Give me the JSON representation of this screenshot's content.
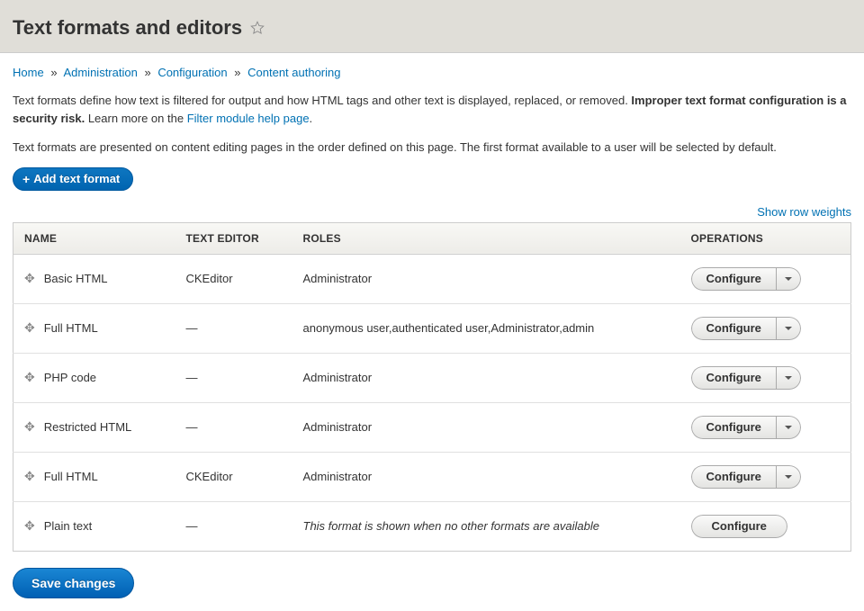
{
  "page_title": "Text formats and editors",
  "breadcrumbs": [
    "Home",
    "Administration",
    "Configuration",
    "Content authoring"
  ],
  "intro": {
    "part1": "Text formats define how text is filtered for output and how HTML tags and other text is displayed, replaced, or removed. ",
    "strong": "Improper text format configuration is a security risk.",
    "part2": " Learn more on the ",
    "link": "Filter module help page",
    "part3": "."
  },
  "intro2": "Text formats are presented on content editing pages in the order defined on this page. The first format available to a user will be selected by default.",
  "buttons": {
    "add": "Add text format",
    "save": "Save changes",
    "show_weights": "Show row weights",
    "configure": "Configure"
  },
  "table": {
    "headers": {
      "name": "NAME",
      "editor": "TEXT EDITOR",
      "roles": "ROLES",
      "ops": "OPERATIONS"
    },
    "rows": [
      {
        "name": "Basic HTML",
        "editor": "CKEditor",
        "roles": "Administrator",
        "split": true
      },
      {
        "name": "Full HTML",
        "editor": "—",
        "roles": "anonymous user,authenticated user,Administrator,admin",
        "split": true
      },
      {
        "name": "PHP code",
        "editor": "—",
        "roles": "Administrator",
        "split": true
      },
      {
        "name": "Restricted HTML",
        "editor": "—",
        "roles": "Administrator",
        "split": true
      },
      {
        "name": "Full HTML",
        "editor": "CKEditor",
        "roles": "Administrator",
        "split": true
      },
      {
        "name": "Plain text",
        "editor": "—",
        "roles_fallback": "This format is shown when no other formats are available",
        "split": false
      }
    ]
  }
}
